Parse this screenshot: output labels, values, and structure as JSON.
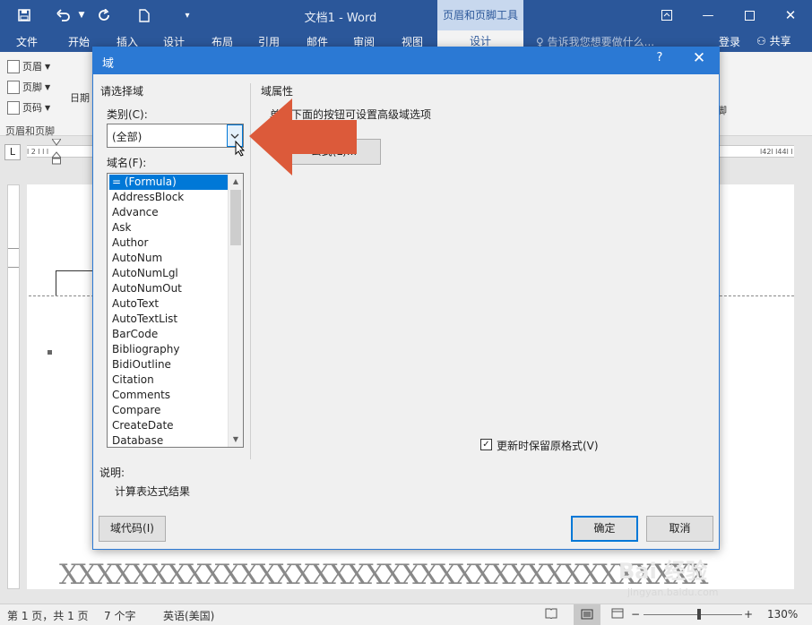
{
  "window": {
    "title": "文档1 - Word",
    "context_tool": "页眉和页脚工具"
  },
  "quick_access": {
    "save_icon": "save-icon",
    "undo_icon": "undo-icon",
    "redo_icon": "redo-icon",
    "new_icon": "new-document-icon",
    "customize_icon": "customize-icon"
  },
  "tabs": [
    "文件",
    "开始",
    "插入",
    "设计",
    "布局",
    "引用",
    "邮件",
    "审阅",
    "视图",
    "设计"
  ],
  "tell_me": "告诉我您想要做什么...",
  "sign_in": "登录",
  "share": "共享",
  "ribbon": {
    "header": "页眉",
    "footer": "页脚",
    "page_number": "页码",
    "group_label": "页眉和页脚",
    "date": "日期",
    "right_fragment": "脚"
  },
  "ruler": {
    "corner": "L",
    "left_marks": "l  2  l  l  l",
    "right_marks": "l42l  l44l  l"
  },
  "dialog": {
    "title": "域",
    "help": "?",
    "close": "✕",
    "choose_field": "请选择域",
    "category_label": "类别(C):",
    "category_value": "(全部)",
    "field_names_label": "域名(F):",
    "fields": [
      "= (Formula)",
      "AddressBlock",
      "Advance",
      "Ask",
      "Author",
      "AutoNum",
      "AutoNumLgl",
      "AutoNumOut",
      "AutoText",
      "AutoTextList",
      "BarCode",
      "Bibliography",
      "BidiOutline",
      "Citation",
      "Comments",
      "Compare",
      "CreateDate",
      "Database"
    ],
    "field_props": "域属性",
    "hint": "单击下面的按钮可设置高级域选项",
    "formula_button": "公式(L)...",
    "preserve_format": "更新时保留原格式(V)",
    "description_label": "说明:",
    "description": "计算表达式结果",
    "field_codes_button": "域代码(I)",
    "ok_button": "确定",
    "cancel_button": "取消"
  },
  "document": {
    "text": "XXXXXXXXXXXXXXXXXXXXXXXXXXXXXXXXXXXX"
  },
  "status": {
    "page": "第 1 页，共 1 页",
    "words": "7 个字",
    "language": "英语(美国)",
    "zoom": "130%"
  },
  "watermark": {
    "brand": "Bai 经验",
    "url": "jingyan.baidu.com"
  },
  "colors": {
    "word_blue": "#2b579a",
    "dialog_blue": "#2b79d4",
    "selection": "#0078d7",
    "arrow": "#dc5a3a"
  }
}
